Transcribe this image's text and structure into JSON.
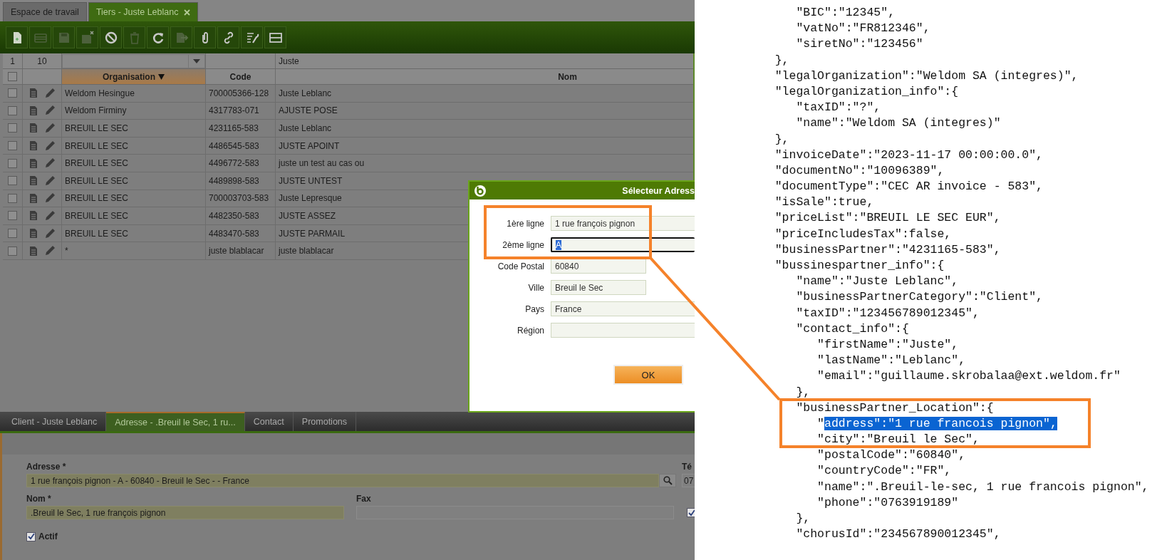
{
  "app": {
    "top_tabs": [
      {
        "label": "Espace de travail",
        "selected": false,
        "closable": false
      },
      {
        "label": "Tiers - Juste Leblanc",
        "selected": true,
        "closable": true
      }
    ],
    "toolbar": [
      {
        "kind": "new",
        "disabled": false
      },
      {
        "kind": "form",
        "disabled": true
      },
      {
        "kind": "save",
        "disabled": true
      },
      {
        "kind": "save-close",
        "disabled": true
      },
      {
        "kind": "cancel",
        "disabled": false
      },
      {
        "kind": "delete",
        "disabled": true
      },
      {
        "kind": "refresh",
        "disabled": false
      },
      {
        "kind": "export",
        "disabled": true
      },
      {
        "kind": "attach",
        "disabled": false
      },
      {
        "kind": "link",
        "disabled": false
      },
      {
        "kind": "tools",
        "disabled": false
      },
      {
        "kind": "layout",
        "disabled": false
      }
    ],
    "grid": {
      "counters": [
        "1",
        "10"
      ],
      "filter_nom": "Juste",
      "header_checked": false,
      "columns": [
        {
          "label": "Organisation",
          "sorted": true
        },
        {
          "label": "Code",
          "sorted": false
        },
        {
          "label": "Nom",
          "sorted": false
        }
      ],
      "rows": [
        {
          "checked": false,
          "organisation": "Weldom Hesingue",
          "code": "700005366-128",
          "nom": "Juste Leblanc"
        },
        {
          "checked": false,
          "organisation": "Weldom Firminy",
          "code": "4317783-071",
          "nom": "AJUSTE POSE"
        },
        {
          "checked": false,
          "organisation": "BREUIL LE SEC",
          "code": "4231165-583",
          "nom": "Juste Leblanc"
        },
        {
          "checked": false,
          "organisation": "BREUIL LE SEC",
          "code": "4486545-583",
          "nom": "JUSTE APOINT"
        },
        {
          "checked": false,
          "organisation": "BREUIL LE SEC",
          "code": "4496772-583",
          "nom": "juste un test au cas ou"
        },
        {
          "checked": false,
          "organisation": "BREUIL LE SEC",
          "code": "4489898-583",
          "nom": "JUSTE UNTEST"
        },
        {
          "checked": false,
          "organisation": "BREUIL LE SEC",
          "code": "700003703-583",
          "nom": "Juste Lepresque"
        },
        {
          "checked": false,
          "organisation": "BREUIL LE SEC",
          "code": "4482350-583",
          "nom": "JUSTE ASSEZ"
        },
        {
          "checked": false,
          "organisation": "BREUIL LE SEC",
          "code": "4483470-583",
          "nom": "JUSTE PARMAIL"
        },
        {
          "checked": false,
          "organisation": "*",
          "code": "juste blablacar",
          "nom": "juste blablacar"
        }
      ]
    },
    "sub_tabs": [
      {
        "label": "Client - Juste Leblanc",
        "selected": false
      },
      {
        "label": "Adresse - .Breuil le Sec, 1 ru...",
        "selected": true
      },
      {
        "label": "Contact",
        "selected": false
      },
      {
        "label": "Promotions",
        "selected": false
      }
    ],
    "form": {
      "address_label": "Adresse *",
      "address_value": "1 rue françois pignon - A - 60840 - Breuil le Sec - - France",
      "phone_label": "Té",
      "phone_value": "07",
      "name_label": "Nom *",
      "name_value": ".Breuil le Sec, 1 rue françois pignon",
      "fax_label": "Fax",
      "side_checked": true,
      "active": {
        "label": "Actif",
        "checked": true
      }
    },
    "dialog": {
      "title": "Sélecteur Adress",
      "fields": [
        {
          "label": "1ère ligne",
          "value": "1 rue françois pignon",
          "kind": "wide",
          "focused": false
        },
        {
          "label": "2ème ligne",
          "value": "A",
          "kind": "wide",
          "focused": true
        },
        {
          "label": "Code Postal",
          "value": "60840",
          "kind": "short",
          "focused": false
        },
        {
          "label": "Ville",
          "value": "Breuil le Sec",
          "kind": "short",
          "focused": false
        },
        {
          "label": "Pays",
          "value": "France",
          "kind": "wide",
          "focused": false
        },
        {
          "label": "Région",
          "kind": "wide",
          "focused": false
        }
      ],
      "ok": "OK"
    }
  },
  "code": {
    "lines": [
      {
        "text": "      \"BIC\":\"12345\","
      },
      {
        "text": "      \"vatNo\":\"FR812346\","
      },
      {
        "text": "      \"siretNo\":\"123456\""
      },
      {
        "text": "   },"
      },
      {
        "text": "   \"legalOrganization\":\"Weldom SA (integres)\","
      },
      {
        "text": "   \"legalOrganization_info\":{"
      },
      {
        "text": "      \"taxID\":\"?\","
      },
      {
        "text": "      \"name\":\"Weldom SA (integres)\""
      },
      {
        "text": "   },"
      },
      {
        "text": "   \"invoiceDate\":\"2023-11-17 00:00:00.0\","
      },
      {
        "text": "   \"documentNo\":\"10096389\","
      },
      {
        "text": "   \"documentType\":\"CEC AR invoice - 583\","
      },
      {
        "text": "   \"isSale\":true,"
      },
      {
        "text": "   \"priceList\":\"BREUIL LE SEC EUR\","
      },
      {
        "text": "   \"priceIncludesTax\":false,"
      },
      {
        "text": "   \"businessPartner\":\"4231165-583\","
      },
      {
        "text": "   \"bussinespartner_info\":{"
      },
      {
        "text": "      \"name\":\"Juste Leblanc\","
      },
      {
        "text": "      \"businessPartnerCategory\":\"Client\","
      },
      {
        "text": "      \"taxID\":\"123456789012345\","
      },
      {
        "text": "      \"contact_info\":{"
      },
      {
        "text": "         \"firstName\":\"Juste\","
      },
      {
        "text": "         \"lastName\":\"Leblanc\","
      },
      {
        "text": "         \"email\":\"guillaume.skrobalaa@ext.weldom.fr\""
      },
      {
        "text": "      },"
      },
      {
        "text": "      \"businessPartner_Location\":{"
      },
      {
        "parts": [
          {
            "text": "         \"",
            "selected": false
          },
          {
            "text": "address\":\"1 rue francois pignon\",",
            "selected": true
          }
        ]
      },
      {
        "text": "         \"city\":\"Breuil le Sec\","
      },
      {
        "text": "         \"postalCode\":\"60840\","
      },
      {
        "text": "         \"countryCode\":\"FR\","
      },
      {
        "text": "         \"name\":\".Breuil-le-sec, 1 rue francois pignon\","
      },
      {
        "text": "         \"phone\":\"0763919189\""
      },
      {
        "text": "      },"
      },
      {
        "text": "      \"chorusId\":\"234567890012345\","
      }
    ]
  }
}
